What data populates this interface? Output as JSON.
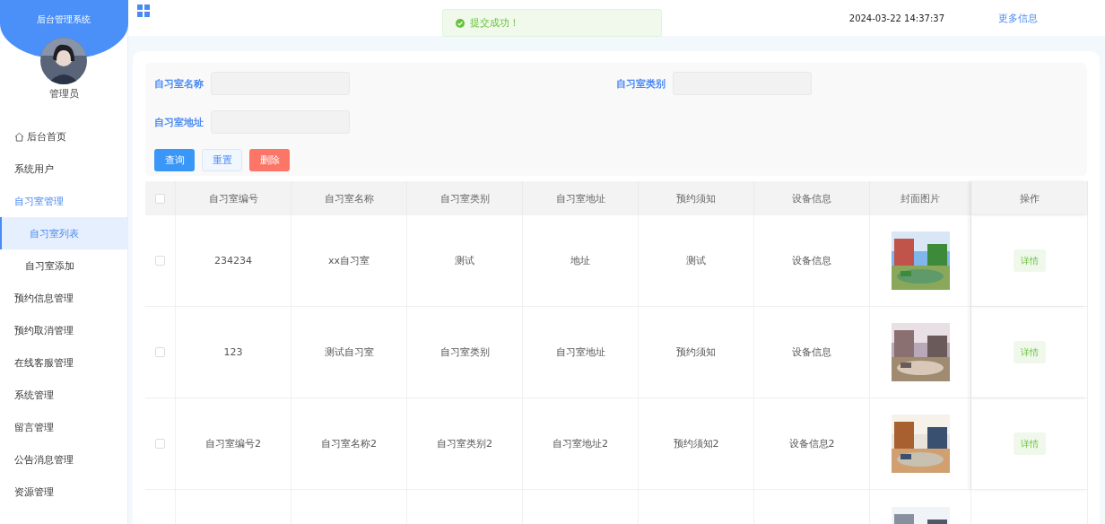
{
  "sidebar": {
    "title": "后台管理系统",
    "user": "管理员",
    "items": [
      {
        "label": "后台首页",
        "selected": false,
        "expanded": false
      },
      {
        "label": "系统用户",
        "selected": false,
        "expanded": false
      },
      {
        "label": "自习室管理",
        "selected": false,
        "expanded": true,
        "children": [
          {
            "label": "自习室列表",
            "selected": true
          },
          {
            "label": "自习室添加",
            "selected": false
          }
        ]
      },
      {
        "label": "预约信息管理",
        "selected": false,
        "expanded": false
      },
      {
        "label": "预约取消管理",
        "selected": false,
        "expanded": false
      },
      {
        "label": "在线客服管理",
        "selected": false,
        "expanded": false
      },
      {
        "label": "系统管理",
        "selected": false,
        "expanded": false
      },
      {
        "label": "留言管理",
        "selected": false,
        "expanded": false
      },
      {
        "label": "公告消息管理",
        "selected": false,
        "expanded": false
      },
      {
        "label": "资源管理",
        "selected": false,
        "expanded": false
      }
    ]
  },
  "header": {
    "datetime": "2024-03-22 14:37:37",
    "more_link": "更多信息"
  },
  "toast": {
    "kind": "success",
    "message": "提交成功！"
  },
  "search": {
    "fields": [
      {
        "label": "自习室名称"
      },
      {
        "label": "自习室类别"
      },
      {
        "label": "自习室地址"
      }
    ],
    "buttons": [
      {
        "label": "查询",
        "kind": "primary"
      },
      {
        "label": "重置",
        "kind": "plain"
      },
      {
        "label": "删除",
        "kind": "danger"
      }
    ]
  },
  "table": {
    "all_checked": false,
    "columns": [
      "自习室编号",
      "自习室名称",
      "自习室类别",
      "自习室地址",
      "预约须知",
      "设备信息",
      "封面图片",
      "操作"
    ],
    "rows": [
      {
        "checked": false,
        "cells": [
          "234234",
          "xx自习室",
          "测试",
          "地址",
          "测试",
          "设备信息"
        ],
        "action": "详情"
      },
      {
        "checked": false,
        "cells": [
          "123",
          "测试自习室",
          "自习室类别",
          "自习室地址",
          "预约须知",
          "设备信息"
        ],
        "action": "详情"
      },
      {
        "checked": false,
        "cells": [
          "自习室编号2",
          "自习室名称2",
          "自习室类别2",
          "自习室地址2",
          "预约须知2",
          "设备信息2"
        ],
        "action": "详情"
      },
      {
        "cells": []
      }
    ]
  }
}
